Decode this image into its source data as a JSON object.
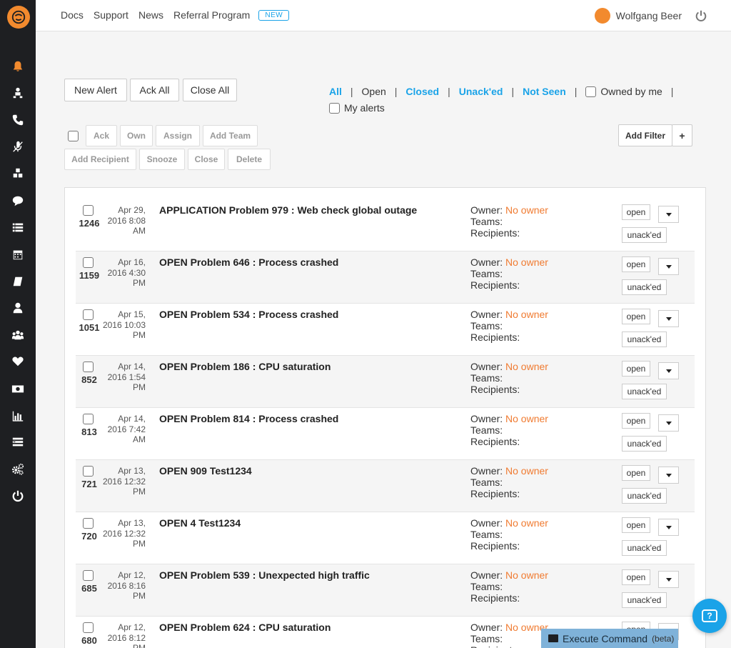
{
  "topnav": {
    "docs": "Docs",
    "support": "Support",
    "news": "News",
    "referral": "Referral Program",
    "new_badge": "NEW"
  },
  "user": {
    "name": "Wolfgang Beer"
  },
  "sidebar": {
    "icons": [
      "bell-icon",
      "user-sitemap-icon",
      "phone-icon",
      "microphone-slash-icon",
      "cubes-icon",
      "comment-icon",
      "list-icon",
      "calendar-icon",
      "book-icon",
      "user-icon",
      "users-icon",
      "heart-icon",
      "money-icon",
      "bar-chart-icon",
      "tasks-icon",
      "gears-icon",
      "power-icon"
    ]
  },
  "toolbar": {
    "new_alert": "New Alert",
    "ack_all": "Ack All",
    "close_all": "Close All",
    "ack": "Ack",
    "own": "Own",
    "assign": "Assign",
    "add_team": "Add Team",
    "add_recipient": "Add Recipient",
    "snooze": "Snooze",
    "close": "Close",
    "delete": "Delete",
    "add_filter": "Add Filter",
    "plus": "+"
  },
  "filters": {
    "all": "All",
    "open": "Open",
    "closed": "Closed",
    "unacked": "Unack'ed",
    "not_seen": "Not Seen",
    "owned_by_me": "Owned by me",
    "my_alerts": "My alerts",
    "sep": "|"
  },
  "labels": {
    "owner": "Owner:",
    "teams": "Teams:",
    "recipients": "Recipients:",
    "open": "open",
    "unacked": "unack'ed"
  },
  "alerts": [
    {
      "id": "1246",
      "date1": "Apr 29,",
      "date2": "2016 8:08",
      "date3": "AM",
      "title": "APPLICATION Problem 979 : Web check global outage",
      "owner": "No owner"
    },
    {
      "id": "1159",
      "date1": "Apr 16,",
      "date2": "2016 4:30",
      "date3": "PM",
      "title": "OPEN Problem 646 : Process crashed",
      "owner": "No owner"
    },
    {
      "id": "1051",
      "date1": "Apr 15,",
      "date2": "2016 10:03",
      "date3": "PM",
      "title": "OPEN Problem 534 : Process crashed",
      "owner": "No owner"
    },
    {
      "id": "852",
      "date1": "Apr 14,",
      "date2": "2016 1:54",
      "date3": "PM",
      "title": "OPEN Problem 186 : CPU saturation",
      "owner": "No owner"
    },
    {
      "id": "813",
      "date1": "Apr 14,",
      "date2": "2016 7:42",
      "date3": "AM",
      "title": "OPEN Problem 814 : Process crashed",
      "owner": "No owner"
    },
    {
      "id": "721",
      "date1": "Apr 13,",
      "date2": "2016 12:32",
      "date3": "PM",
      "title": "OPEN 909 Test1234",
      "owner": "No owner"
    },
    {
      "id": "720",
      "date1": "Apr 13,",
      "date2": "2016 12:32",
      "date3": "PM",
      "title": "OPEN 4 Test1234",
      "owner": "No owner"
    },
    {
      "id": "685",
      "date1": "Apr 12,",
      "date2": "2016 8:16",
      "date3": "PM",
      "title": "OPEN Problem 539 : Unexpected high traffic",
      "owner": "No owner"
    },
    {
      "id": "680",
      "date1": "Apr 12,",
      "date2": "2016 8:12",
      "date3": "PM",
      "title": "OPEN Problem 624 : CPU saturation",
      "owner": "No owner"
    }
  ],
  "footer": {
    "execute": "Execute Command",
    "beta": "(beta)",
    "help": "?"
  },
  "colors": {
    "accent": "#1aa3e8",
    "brand_orange": "#f28a2e",
    "no_owner": "#f07b31",
    "sidebar_bg": "#1e1f22"
  }
}
